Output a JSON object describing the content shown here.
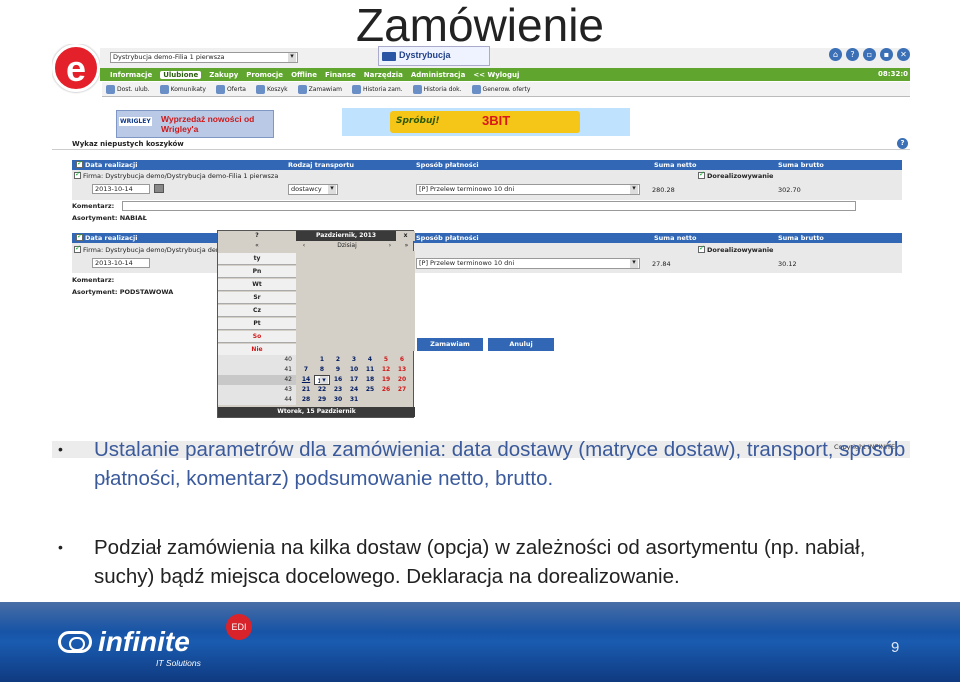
{
  "slide": {
    "title": "Zamówienie",
    "page_number": "9",
    "copyright": "Copyright INFINITE",
    "bullets": [
      "Ustalanie parametrów dla zamówienia: data dostawy (matryce dostaw), transport, sposób płatności, komentarz) podsumowanie netto, brutto.",
      "Podział zamówienia na kilka dostaw (opcja) w zależności od asortymentu (np. nabiał, suchy) bądź miejsca docelowego. Deklaracja na dorealizowanie."
    ],
    "footer": {
      "brand": "infinite",
      "tagline": "IT Solutions",
      "badge": "EDI"
    }
  },
  "app": {
    "logo_letter": "e",
    "company_select": "Dystrybucja demo-Filia 1 pierwsza",
    "brand": "Dystrybucja",
    "clock": "08:32:0",
    "menu": [
      "Informacje",
      "Ulubione",
      "Zakupy",
      "Promocje",
      "Offline",
      "Finanse",
      "Narzędzia",
      "Administracja",
      "<< Wyloguj"
    ],
    "toolbar": [
      "Dost. ulub.",
      "Komunikaty",
      "Oferta",
      "Koszyk",
      "Zamawiam",
      "Historia zam.",
      "Historia dok.",
      "Generow. oferty"
    ],
    "banner1_brand": "WRIGLEY",
    "banner1_text": "Wyprzedaż nowości od Wrigley'a",
    "banner2_left": "Spróbuj!",
    "banner2_right": "3BIT",
    "section_title": "Wykaz niepustych koszyków",
    "help": "?"
  },
  "columns": [
    "Data realizacji",
    "Rodzaj transportu",
    "Sposób płatności",
    "Suma netto",
    "Suma brutto"
  ],
  "orders": [
    {
      "firm": "Firma: Dystrybucja demo/Dystrybucja demo-Filia 1 pierwsza",
      "date": "2013-10-14",
      "transport": "dostawcy",
      "payment": "[P] Przelew terminowo 10 dni",
      "netto": "280.28",
      "brutto": "302.70",
      "dorealizowane": "Dorealizowywanie",
      "comment_label": "Komentarz:",
      "assortment": "Asortyment: NABIAŁ"
    },
    {
      "firm": "Firma: Dystrybucja demo/Dystrybucja demo-Filia 1 pierwsza",
      "date": "2013-10-14",
      "transport": "",
      "payment": "[P] Przelew terminowo 10 dni",
      "netto": "27.84",
      "brutto": "30.12",
      "dorealizowane": "Dorealizowywanie",
      "comment_label": "Komentarz:",
      "assortment": "Asortyment: PODSTAWOWA"
    }
  ],
  "buttons": {
    "order": "Zamawiam",
    "cancel": "Anuluj"
  },
  "calendar": {
    "help": "?",
    "month": "Pazdziernik, 2013",
    "close": "x",
    "nav": [
      "«",
      "‹",
      "Dzisiaj",
      "›",
      "»"
    ],
    "weekdays": [
      "ty",
      "Pn",
      "Wt",
      "Sr",
      "Cz",
      "Pt",
      "So",
      "Nie"
    ],
    "weeks": [
      {
        "num": "40",
        "days": [
          "1",
          "2",
          "3",
          "4",
          "5",
          "6"
        ]
      },
      {
        "num": "41",
        "days": [
          "7",
          "8",
          "9",
          "10",
          "11",
          "12",
          "13"
        ]
      },
      {
        "num": "42",
        "days": [
          "14",
          "15",
          "16",
          "17",
          "18",
          "19",
          "20"
        ]
      },
      {
        "num": "43",
        "days": [
          "21",
          "22",
          "23",
          "24",
          "25",
          "26",
          "27"
        ]
      },
      {
        "num": "44",
        "days": [
          "28",
          "29",
          "30",
          "31"
        ]
      }
    ],
    "footer": "Wtorek, 15 Pazdziernik"
  }
}
